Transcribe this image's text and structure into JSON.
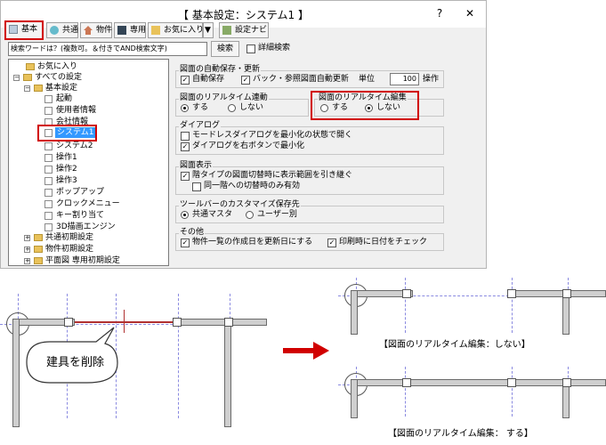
{
  "window": {
    "title": "【 基本設定：システム1 】",
    "controls": [
      "?",
      "✕"
    ]
  },
  "toolbar": {
    "buttons": [
      "基本",
      "共通",
      "物件",
      "専用",
      "お気に入り",
      "設定ナビ"
    ],
    "dropdown": "▼"
  },
  "search": {
    "value": "検索ワードは？(複数可。＆付きでAND検索文字)",
    "button": "検索",
    "detail_label": "詳細検索"
  },
  "tree": {
    "favorites": "お気に入り",
    "all": "すべての設定",
    "basic": "基本設定",
    "basic_children": [
      "起動",
      "使用者情報",
      "会社情報",
      "システム1",
      "システム2",
      "操作1",
      "操作2",
      "操作3",
      "ポップアップ",
      "クロックメニュー",
      "キー割り当て",
      "3D描画エンジン"
    ],
    "others": [
      "共通初期設定",
      "物件初期設定",
      "平面図 専用初期設定"
    ]
  },
  "settings": {
    "autosave": {
      "title": "図面の自動保存・更新",
      "auto_save": "自動保存",
      "backup": "バック・参照図面自動更新",
      "unit_label": "単位",
      "unit_value": "100",
      "unit_suffix": "操作"
    },
    "realtime_link": {
      "title": "図面のリアルタイム連動",
      "yes": "する",
      "no": "しない"
    },
    "realtime_edit": {
      "title": "図面のリアルタイム編集",
      "yes": "する",
      "no": "しない"
    },
    "dialog": {
      "title": "ダイアログ",
      "modeless": "モードレスダイアログを最小化の状態で開く",
      "right_click": "ダイアログを右ボタンで最小化"
    },
    "display": {
      "title": "図面表示",
      "keep_range": "階タイプの図面切替時に表示範囲を引き継ぐ",
      "same_floor": "同一階への切替時のみ有効"
    },
    "toolbar_custom": {
      "title": "ツールバーのカスタマイズ保存先",
      "common": "共通マスタ",
      "per_user": "ユーザー別"
    },
    "other": {
      "title": "その他",
      "update_date": "物件一覧の作成日を更新日にする",
      "print_date": "印刷時に日付をチェック"
    }
  },
  "illustration": {
    "callout": "建具を削除",
    "caption_no": "【図面のリアルタイム編集：しない】",
    "caption_yes": "【図面のリアルタイム編集： する】"
  },
  "colors": {
    "highlight": "#d10000",
    "selection": "#3399ff",
    "arrow": "#d10000"
  }
}
